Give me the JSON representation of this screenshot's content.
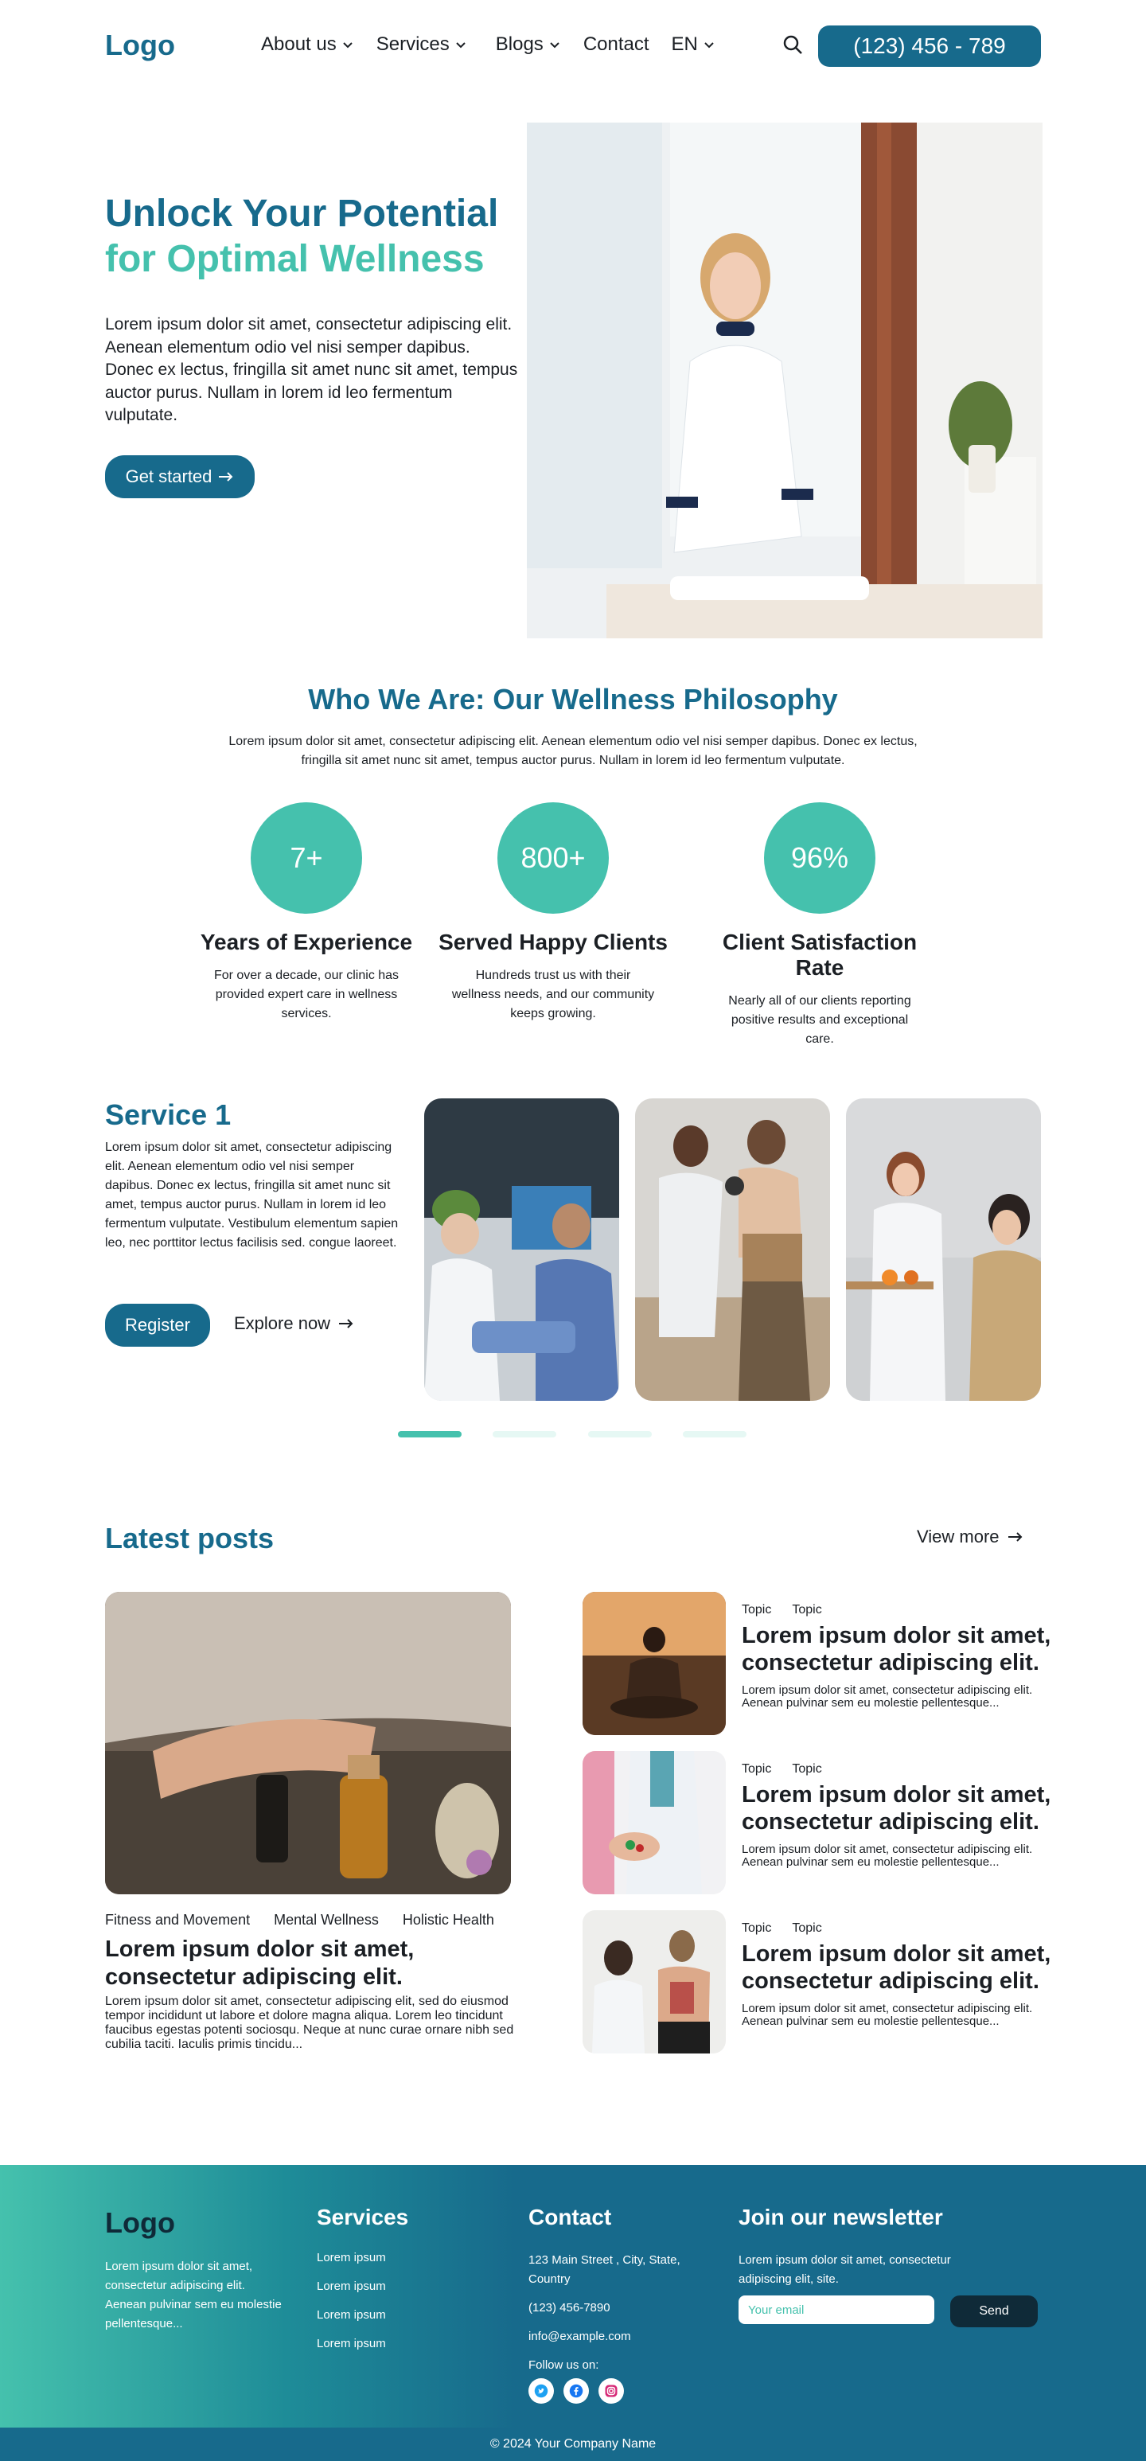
{
  "header": {
    "logo": "Logo",
    "nav": [
      {
        "label": "About us"
      },
      {
        "label": "Services"
      },
      {
        "label": "Blogs"
      },
      {
        "label": "Contact"
      },
      {
        "label": "EN"
      }
    ],
    "phone": "(123) 456 - 789"
  },
  "hero": {
    "title_line1": "Unlock Your Potential",
    "title_line2": "for Optimal Wellness",
    "body": "Lorem ipsum dolor sit amet, consectetur adipiscing elit. Aenean elementum odio vel nisi semper dapibus. Donec ex lectus, fringilla sit amet nunc sit amet, tempus auctor purus. Nullam in lorem id leo fermentum vulputate.",
    "cta": "Get started"
  },
  "philosophy": {
    "title": "Who We Are: Our Wellness Philosophy",
    "body": "Lorem ipsum dolor sit amet, consectetur adipiscing elit. Aenean elementum odio vel nisi semper dapibus. Donec ex lectus, fringilla sit amet nunc sit amet, tempus auctor purus. Nullam in lorem id leo fermentum vulputate.",
    "stats": [
      {
        "value": "7+",
        "title": "Years of Experience",
        "desc": "For over a decade, our clinic has provided expert care in wellness services."
      },
      {
        "value": "800+",
        "title": "Served Happy Clients",
        "desc": "Hundreds trust us with their wellness needs, and our community keeps growing."
      },
      {
        "value": "96%",
        "title": "Client Satisfaction Rate",
        "desc": "Nearly all of our clients reporting positive results and exceptional care."
      }
    ]
  },
  "service": {
    "title": "Service 1",
    "body": "Lorem ipsum dolor sit amet, consectetur adipiscing elit. Aenean elementum odio vel nisi semper dapibus. Donec ex lectus, fringilla sit amet nunc sit amet, tempus auctor purus. Nullam in lorem id leo fermentum vulputate. Vestibulum elementum sapien leo, nec porttitor lectus facilisis sed. congue laoreet.",
    "register": "Register",
    "explore": "Explore now",
    "active_slide": 1,
    "slide_count": 4
  },
  "posts": {
    "title": "Latest posts",
    "view_more": "View more",
    "featured": {
      "tags": [
        "Fitness and Movement",
        "Mental Wellness",
        "Holistic Health"
      ],
      "title": "Lorem ipsum dolor sit amet, consectetur adipiscing elit.",
      "desc": "Lorem ipsum dolor sit amet, consectetur adipiscing elit, sed do eiusmod tempor incididunt ut labore et dolore magna aliqua. Lorem leo tincidunt faucibus egestas potenti sociosqu. Neque at nunc curae ornare nibh sed cubilia taciti. Iaculis primis tincidu..."
    },
    "side": [
      {
        "tags": [
          "Topic",
          "Topic"
        ],
        "title": "Lorem ipsum dolor sit amet, consectetur adipiscing elit.",
        "desc": "Lorem ipsum dolor sit amet, consectetur adipiscing elit. Aenean pulvinar sem eu molestie pellentesque..."
      },
      {
        "tags": [
          "Topic",
          "Topic"
        ],
        "title": "Lorem ipsum dolor sit amet, consectetur adipiscing elit.",
        "desc": "Lorem ipsum dolor sit amet, consectetur adipiscing elit. Aenean pulvinar sem eu molestie pellentesque..."
      },
      {
        "tags": [
          "Topic",
          "Topic"
        ],
        "title": "Lorem ipsum dolor sit amet, consectetur adipiscing elit.",
        "desc": "Lorem ipsum dolor sit amet, consectetur adipiscing elit. Aenean pulvinar sem eu molestie pellentesque..."
      }
    ]
  },
  "footer": {
    "logo": "Logo",
    "about": "Lorem ipsum dolor sit amet, consectetur adipiscing elit. Aenean pulvinar sem eu molestie pellentesque...",
    "services_title": "Services",
    "services": [
      "Lorem ipsum",
      "Lorem ipsum",
      "Lorem ipsum",
      "Lorem ipsum"
    ],
    "contact_title": "Contact",
    "address": "123 Main Street , City, State, Country",
    "phone": "(123) 456-7890",
    "email": "info@example.com",
    "follow": "Follow us on:",
    "newsletter_title": "Join our newsletter",
    "newsletter_desc": "Lorem ipsum dolor sit amet, consectetur adipiscing elit, site.",
    "email_placeholder": "Your email",
    "send": "Send",
    "copyright": "© 2024 Your Company Name"
  },
  "colors": {
    "primary": "#176a8c",
    "accent": "#45c1ad",
    "dark": "#0f2a38"
  }
}
